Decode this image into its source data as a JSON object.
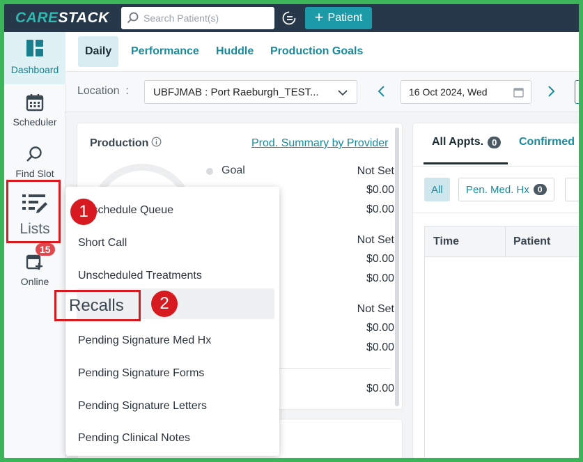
{
  "app": {
    "logo_prefix": "CARE",
    "logo_suffix": "STACK",
    "search_placeholder": "Search Patient(s)",
    "patient_button": "Patient"
  },
  "nav": {
    "dashboard": "Dashboard",
    "scheduler": "Scheduler",
    "find_slot": "Find Slot",
    "lists": "Lists",
    "online": "Online",
    "online_badge": "15"
  },
  "tabs": [
    "Daily",
    "Performance",
    "Huddle",
    "Production Goals"
  ],
  "filters": {
    "location_label": "Location",
    "location_sep": ":",
    "location_value": "UBFJMAB : Port Raeburgh_TEST...",
    "date_value": "16 Oct 2024, Wed"
  },
  "production": {
    "title": "Production",
    "summary_link": "Prod. Summary by Provider",
    "goal_label": "Goal",
    "values": [
      "Not Set",
      "$0.00",
      "$0.00",
      "Not Set",
      "$0.00",
      "$0.00",
      "Not Set",
      "$0.00",
      "$0.00",
      "$0.00"
    ]
  },
  "appointments": {
    "tab_all": "All Appts.",
    "tab_all_count": "0",
    "tab_confirmed": "Confirmed",
    "chip_all": "All",
    "chip_pending": "Pen. Med. Hx",
    "chip_pending_count": "0",
    "col_time": "Time",
    "col_patient": "Patient"
  },
  "menu": {
    "items": [
      "Reschedule Queue",
      "Short Call",
      "Unscheduled Treatments",
      "Recalls",
      "Pending Signature Med Hx",
      "Pending Signature Forms",
      "Pending Signature Letters",
      "Pending Clinical Notes"
    ]
  },
  "steps": [
    "1",
    "2"
  ],
  "colors": {
    "topbar": "#26384a",
    "accent": "#1a8a9a",
    "annotation": "#d71920",
    "border": "#3cb55a"
  }
}
